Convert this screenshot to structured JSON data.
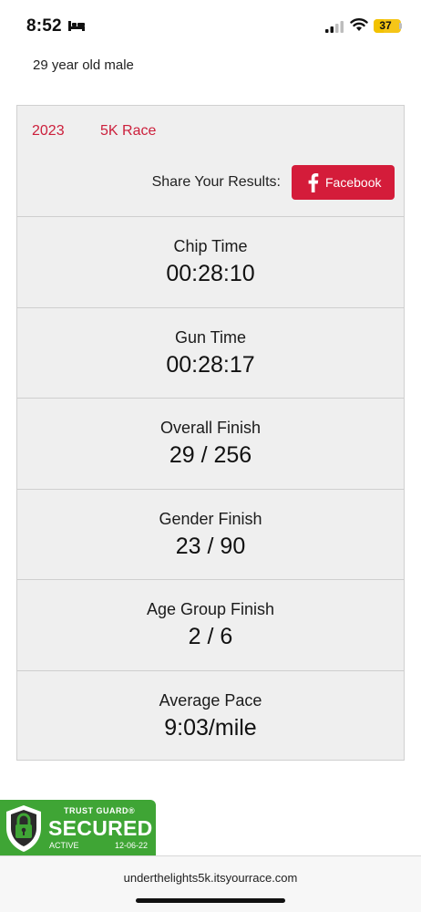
{
  "status_bar": {
    "time": "8:52",
    "battery": "37",
    "battery_fraction": 0.37,
    "icons": [
      "bed-icon",
      "cellular-signal-icon",
      "wifi-icon",
      "battery-icon"
    ]
  },
  "participant": {
    "subtitle": "29 year old male"
  },
  "race": {
    "year": "2023",
    "name": "5K Race"
  },
  "share": {
    "label": "Share Your Results:",
    "facebook_label": "Facebook",
    "facebook_icon": "facebook-f-icon",
    "button_color": "#d41c3a"
  },
  "stats": [
    {
      "label": "Chip Time",
      "value": "00:28:10"
    },
    {
      "label": "Gun Time",
      "value": "00:28:17"
    },
    {
      "label": "Overall Finish",
      "value": "29 / 256"
    },
    {
      "label": "Gender Finish",
      "value": "23 / 90"
    },
    {
      "label": "Age Group Finish",
      "value": "2 / 6"
    },
    {
      "label": "Average Pace",
      "value": "9:03/mile"
    }
  ],
  "badge": {
    "top_text": "TRUST GUARD®",
    "main_text": "SECURED",
    "status": "ACTIVE",
    "date": "12-06-22",
    "color": "#3fa535",
    "icon": "shield-lock-icon"
  },
  "browser": {
    "url": "underthelights5k.itsyourrace.com"
  },
  "accent_color": "#cc1f3b"
}
